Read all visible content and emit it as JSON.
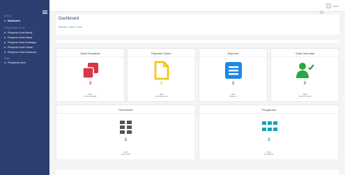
{
  "sidebar": {
    "sections": [
      {
        "label": "MENU",
        "items": [
          {
            "label": "Dashboard",
            "active": true
          }
        ]
      },
      {
        "label": "Pengelolaan Surat",
        "items": [
          {
            "label": "Pelaporan Surat Masuk"
          },
          {
            "label": "Pelaporan Surat Keluar"
          },
          {
            "label": "Pelaporan Surat Undangan"
          },
          {
            "label": "Pelaporan Surat Edaran"
          },
          {
            "label": "Pelaporan Surat Keputusan"
          }
        ]
      },
      {
        "label": "Data",
        "items": [
          {
            "label": "Pengaturan Akun"
          }
        ]
      }
    ]
  },
  "topbar": {
    "user_label": "admin"
  },
  "header": {
    "title": "Dashboard",
    "breadcrumb": "Beranda / Sistem / Data"
  },
  "cards_row1": [
    {
      "title": "Surat Keluarkan",
      "value": "3",
      "color": "#dc3545",
      "icon": "copy-icon",
      "small1": "Data",
      "small2": "Surat Keluarkan"
    },
    {
      "title": "Disposisi Dalam",
      "value": "3",
      "color": "#f5c518",
      "icon": "document-icon",
      "small1": "Data",
      "small2": "Surat Disposisi"
    },
    {
      "title": "Disposisi",
      "value": "2",
      "color": "#1e88e5",
      "icon": "message-icon",
      "small1": "Data",
      "small2": "Disposisi"
    },
    {
      "title": "Surat Informasi",
      "value": "0",
      "color": "#28a745",
      "icon": "users-icon",
      "small1": "Data",
      "small2": "Surat Informasi"
    }
  ],
  "cards_row2": [
    {
      "title": "Pemerintah",
      "value": "1",
      "color": "#555555",
      "icon": "grid-icon",
      "small1": "Data",
      "small2": "Pemerintah"
    },
    {
      "title": "Pengaturan",
      "value": "2",
      "color": "#17a2b8",
      "icon": "grid-icon",
      "small1": "Data",
      "small2": "Pengaturan"
    }
  ]
}
